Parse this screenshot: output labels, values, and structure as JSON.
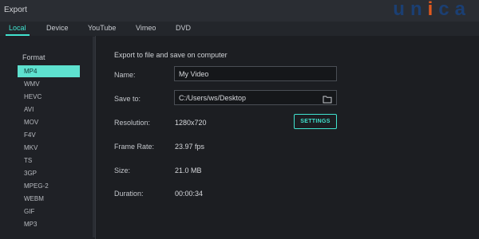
{
  "window": {
    "title": "Export"
  },
  "logo": {
    "part1": "u",
    "part2": "n",
    "part3": "i",
    "part4": "c",
    "part5": "a"
  },
  "tabs": [
    {
      "label": "Local",
      "active": true
    },
    {
      "label": "Device",
      "active": false
    },
    {
      "label": "YouTube",
      "active": false
    },
    {
      "label": "Vimeo",
      "active": false
    },
    {
      "label": "DVD",
      "active": false
    }
  ],
  "sidebar": {
    "heading": "Format",
    "formats": [
      "MP4",
      "WMV",
      "HEVC",
      "AVI",
      "MOV",
      "F4V",
      "MKV",
      "TS",
      "3GP",
      "MPEG-2",
      "WEBM",
      "GIF",
      "MP3"
    ],
    "selected": "MP4"
  },
  "main": {
    "description": "Export to file and save on computer",
    "name_label": "Name:",
    "name_value": "My Video",
    "save_label": "Save to:",
    "save_value": "C:/Users/ws/Desktop",
    "resolution_label": "Resolution:",
    "resolution_value": "1280x720",
    "settings_button": "SETTINGS",
    "framerate_label": "Frame Rate:",
    "framerate_value": "23.97 fps",
    "size_label": "Size:",
    "size_value": "21.0 MB",
    "duration_label": "Duration:",
    "duration_value": "00:00:34"
  },
  "colors": {
    "accent": "#41e3cf",
    "selected_bg": "#5ee1cf",
    "panel": "#1c1e22"
  },
  "icons": {
    "folder": "folder-icon"
  }
}
